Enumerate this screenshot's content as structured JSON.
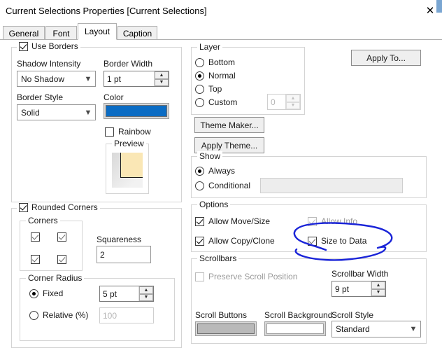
{
  "window": {
    "title": "Current Selections Properties [Current Selections]",
    "close_icon": "close-icon"
  },
  "tabs": [
    {
      "label": "General",
      "active": false
    },
    {
      "label": "Font",
      "active": false
    },
    {
      "label": "Layout",
      "active": true
    },
    {
      "label": "Caption",
      "active": false
    }
  ],
  "borders": {
    "group_label": "Use Borders",
    "group_checked": true,
    "shadow_intensity_label": "Shadow Intensity",
    "shadow_intensity_value": "No Shadow",
    "border_width_label": "Border Width",
    "border_width_value": "1 pt",
    "border_style_label": "Border Style",
    "border_style_value": "Solid",
    "color_label": "Color",
    "color_value": "#0b6cc4",
    "rainbow_label": "Rainbow",
    "rainbow_checked": false,
    "preview_label": "Preview",
    "preview_fill": "#fae7b5",
    "preview_shadow": "#d9d9d9"
  },
  "rounded": {
    "group_label": "Rounded Corners",
    "group_checked": true,
    "corners_label": "Corners",
    "corners_checked": [
      true,
      true,
      true,
      true
    ],
    "squareness_label": "Squareness",
    "squareness_value": "2",
    "corner_radius_label": "Corner Radius",
    "fixed_label": "Fixed",
    "fixed_selected": true,
    "fixed_value": "5 pt",
    "relative_label": "Relative (%)",
    "relative_selected": false,
    "relative_value": "100"
  },
  "layer": {
    "group_label": "Layer",
    "options": [
      {
        "label": "Bottom",
        "selected": false
      },
      {
        "label": "Normal",
        "selected": true
      },
      {
        "label": "Top",
        "selected": false
      },
      {
        "label": "Custom",
        "selected": false
      }
    ],
    "custom_value": "0"
  },
  "theme": {
    "theme_maker_label": "Theme Maker...",
    "apply_theme_label": "Apply Theme..."
  },
  "show": {
    "group_label": "Show",
    "always_label": "Always",
    "always_selected": true,
    "conditional_label": "Conditional",
    "conditional_selected": false,
    "conditional_value": ""
  },
  "options": {
    "group_label": "Options",
    "allow_move_size_label": "Allow Move/Size",
    "allow_move_size_checked": true,
    "allow_copy_clone_label": "Allow Copy/Clone",
    "allow_copy_clone_checked": true,
    "allow_info_label": "Allow Info",
    "allow_info_checked": true,
    "allow_info_disabled": true,
    "size_to_data_label": "Size to Data",
    "size_to_data_checked": true,
    "size_to_data_highlighted": true
  },
  "scrollbars": {
    "group_label": "Scrollbars",
    "preserve_scroll_label": "Preserve Scroll Position",
    "preserve_scroll_checked": false,
    "preserve_scroll_disabled": true,
    "scrollbar_width_label": "Scrollbar Width",
    "scrollbar_width_value": "9 pt",
    "scroll_buttons_label": "Scroll Buttons",
    "scroll_buttons_color": "#b9b9b9",
    "scroll_background_label": "Scroll Background",
    "scroll_background_color": "#ffffff",
    "scroll_style_label": "Scroll Style",
    "scroll_style_value": "Standard"
  },
  "actions": {
    "apply_to_label": "Apply To..."
  },
  "annotation": {
    "color": "#1a24d8",
    "shape": "hand-drawn-ellipse",
    "target": "Size to Data"
  }
}
